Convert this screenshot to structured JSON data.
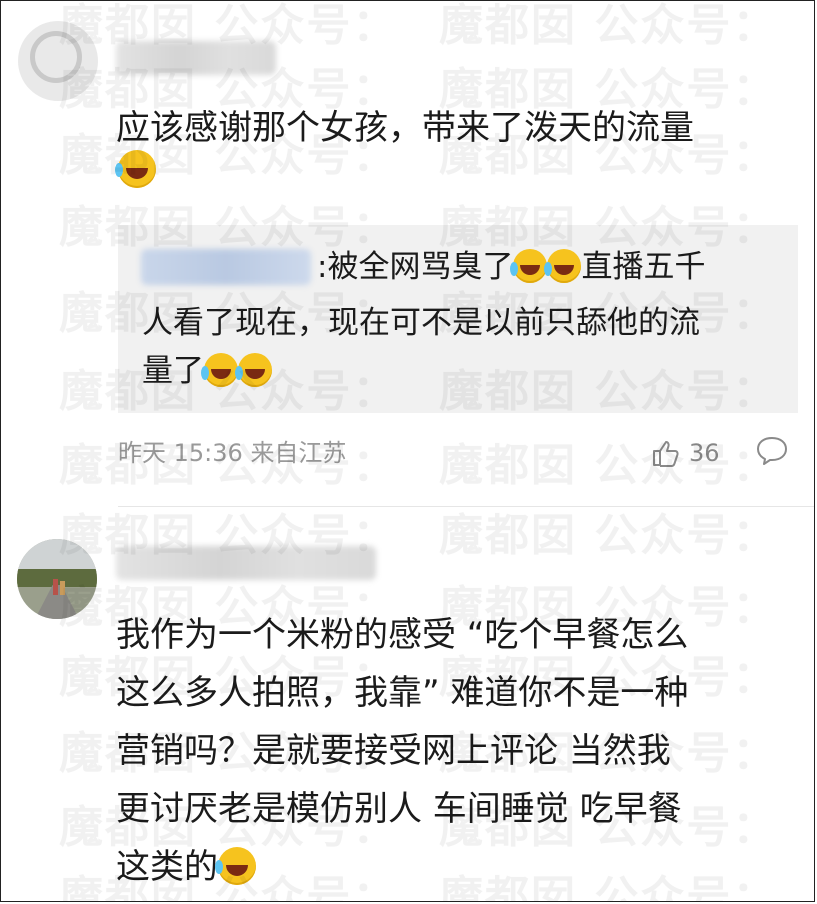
{
  "comments": [
    {
      "text": "应该感谢那个女孩，带来了泼天的流量",
      "emoji": "laugh-cry-icon",
      "reply": {
        "text_line1": ":被全网骂臭了",
        "text_line1_after": "直播五千",
        "text_line2": "人看了现在，现在可不是以前只舔他的流",
        "text_line3": "量了"
      },
      "time": "昨天 15:36",
      "location": "来自江苏",
      "likes": "36"
    },
    {
      "lines": [
        "我作为一个米粉的感受 “吃个早餐怎么",
        "这么多人拍照，我靠” 难道你不是一种",
        "营销吗？是就要接受网上评论 当然我",
        "更讨厌老是模仿别人 车间睡觉 吃早餐",
        "这类的"
      ],
      "emoji": "laugh-cry-icon"
    }
  ],
  "watermark": "魔都囡 公众号：",
  "colors": {
    "meta_gray": "#9a9a9a",
    "quote_bg": "#f1f1f1",
    "emoji": "#f6c31e"
  }
}
